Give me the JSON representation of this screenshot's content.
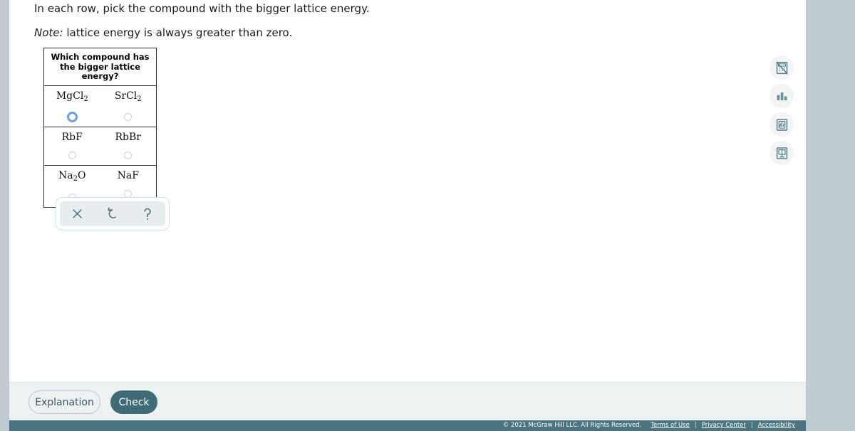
{
  "prompt": {
    "main": "In each row, pick the compound with the bigger lattice energy.",
    "note_label": "Note:",
    "note_text": " lattice energy is always greater than zero."
  },
  "table": {
    "header": "Which compound has the bigger lattice energy?",
    "rows": [
      {
        "left": {
          "formula_html": "MgCl<sub>2</sub>",
          "text": "MgCl2",
          "selected": false,
          "focused": true
        },
        "right": {
          "formula_html": "SrCl<sub>2</sub>",
          "text": "SrCl2",
          "selected": false,
          "focused": false
        }
      },
      {
        "left": {
          "formula_html": "RbF",
          "text": "RbF",
          "selected": false,
          "focused": false
        },
        "right": {
          "formula_html": "RbBr",
          "text": "RbBr",
          "selected": false,
          "focused": false
        }
      },
      {
        "left": {
          "formula_html": "Na<sub>2</sub>O",
          "text": "Na2O",
          "selected": false,
          "focused": false
        },
        "right": {
          "formula_html": "NaF",
          "text": "NaF",
          "selected": false,
          "focused": false
        }
      }
    ]
  },
  "tool_palette": {
    "buttons": [
      {
        "name": "clear-icon",
        "label": "Clear"
      },
      {
        "name": "undo-icon",
        "label": "Undo"
      },
      {
        "name": "help-icon",
        "label": "Help"
      }
    ]
  },
  "utility_rail": {
    "buttons": [
      {
        "name": "calculator-off-icon",
        "label": "Calculator unavailable"
      },
      {
        "name": "bar-chart-icon",
        "label": "Data chart"
      },
      {
        "name": "periodic-table-icon",
        "label": "Periodic table"
      },
      {
        "name": "reference-book-icon",
        "label": "Reference"
      }
    ]
  },
  "actions": {
    "explanation_label": "Explanation",
    "check_label": "Check"
  },
  "footer": {
    "copyright": "© 2021 McGraw Hill LLC. All Rights Reserved.",
    "links": [
      "Terms of Use",
      "Privacy Center",
      "Accessibility"
    ],
    "separator": "|"
  },
  "colors": {
    "page_background": "#bfcbd1",
    "content_background": "#ffffff",
    "action_bar": "#eef1f2",
    "footer_bar": "#4a7480",
    "check_button": "#3e6b76",
    "focus_ring": "#6e9fe0",
    "icon_teal": "#557f8c"
  }
}
